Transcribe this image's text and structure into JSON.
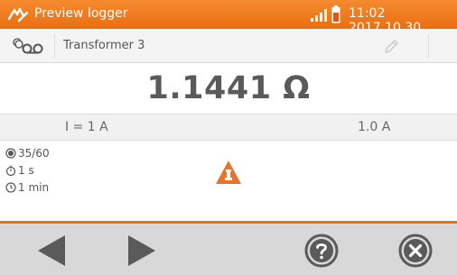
{
  "header": {
    "title": "Preview logger",
    "datetime": "11:02 2017.10.30",
    "background": "#ee7a20"
  },
  "logger": {
    "name": "Transformer 3",
    "icon": "logger-icon",
    "edit_icon": "pencil-icon"
  },
  "measurement": {
    "result": "1.1441 Ω",
    "set_current": "I = 1 A",
    "measured_current": "1.0 A"
  },
  "info": {
    "memory": "35/60",
    "interval": "1 s",
    "duration": "1 min",
    "warning_icon": "warning-icon"
  },
  "footer": {
    "buttons": [
      "prev-icon",
      "next-icon",
      "help-icon",
      "close-icon"
    ],
    "accent": "#e96f12"
  }
}
